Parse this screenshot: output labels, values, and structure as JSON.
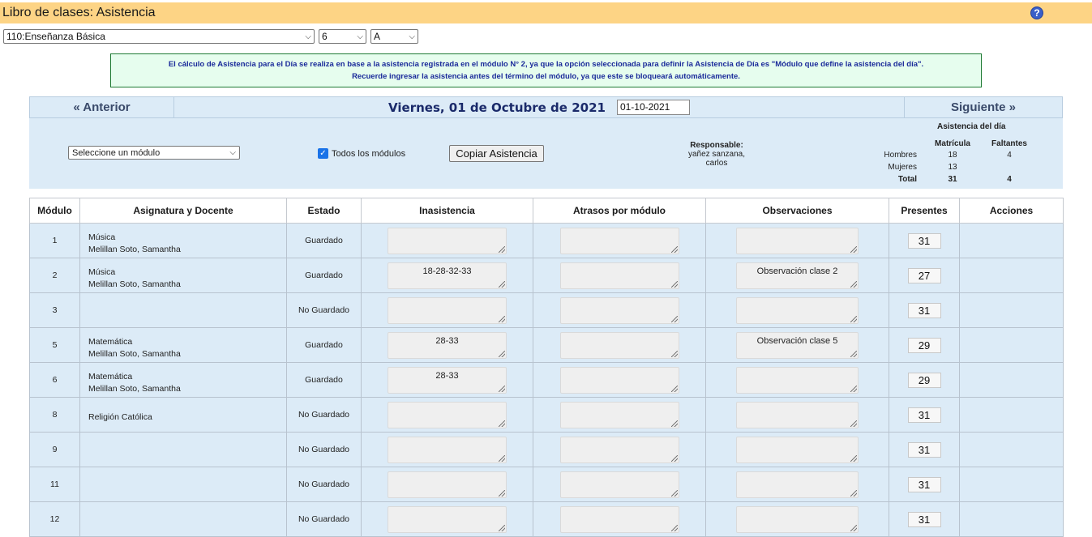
{
  "header": {
    "title": "Libro de clases: Asistencia",
    "help_icon": "?"
  },
  "filters": {
    "curso": "110:Enseñanza Básica",
    "nivel": "6",
    "letra": "A"
  },
  "notice": {
    "line1": "El cálculo de Asistencia para el Día se realiza en base a la asistencia registrada en el módulo N° 2, ya que la opción seleccionada para definir la Asistencia de Día es \"Módulo que define la asistencia del día\".",
    "line2": "Recuerde ingresar la asistencia antes del término del módulo, ya que este se bloqueará automáticamente."
  },
  "nav": {
    "prev_label": "« Anterior",
    "date_label": "Viernes, 01 de Octubre de 2021",
    "date_value": "01-10-2021",
    "next_label": "Siguiente »"
  },
  "controls": {
    "module_placeholder": "Seleccione un módulo",
    "all_modules_label": "Todos los módulos",
    "all_modules_checked": true,
    "copy_button": "Copiar Asistencia",
    "responsable_label": "Responsable:",
    "responsable_line1": "yañez sanzana,",
    "responsable_line2": "carlos"
  },
  "stats": {
    "title": "Asistencia del día",
    "col_matricula": "Matrícula",
    "col_faltantes": "Faltantes",
    "rows": [
      {
        "label": "Hombres",
        "matricula": "18",
        "faltantes": "4"
      },
      {
        "label": "Mujeres",
        "matricula": "13",
        "faltantes": ""
      },
      {
        "label": "Total",
        "matricula": "31",
        "faltantes": "4"
      }
    ]
  },
  "table": {
    "headers": [
      "Módulo",
      "Asignatura y Docente",
      "Estado",
      "Inasistencia",
      "Atrasos por módulo",
      "Observaciones",
      "Presentes",
      "Acciones"
    ],
    "rows": [
      {
        "modulo": "1",
        "asignatura": "Música",
        "docente": "Melillan Soto, Samantha",
        "estado": "Guardado",
        "inasistencia": "",
        "atrasos": "",
        "observaciones": "",
        "presentes": "31"
      },
      {
        "modulo": "2",
        "asignatura": "Música",
        "docente": "Melillan Soto, Samantha",
        "estado": "Guardado",
        "inasistencia": "18-28-32-33",
        "atrasos": "",
        "observaciones": "Observación clase 2",
        "presentes": "27"
      },
      {
        "modulo": "3",
        "asignatura": "",
        "docente": "",
        "estado": "No Guardado",
        "inasistencia": "",
        "atrasos": "",
        "observaciones": "",
        "presentes": "31"
      },
      {
        "modulo": "5",
        "asignatura": "Matemática",
        "docente": "Melillan Soto, Samantha",
        "estado": "Guardado",
        "inasistencia": "28-33",
        "atrasos": "",
        "observaciones": "Observación clase 5",
        "presentes": "29"
      },
      {
        "modulo": "6",
        "asignatura": "Matemática",
        "docente": "Melillan Soto, Samantha",
        "estado": "Guardado",
        "inasistencia": "28-33",
        "atrasos": "",
        "observaciones": "",
        "presentes": "29"
      },
      {
        "modulo": "8",
        "asignatura": "Religión Católica",
        "docente": "",
        "estado": "No Guardado",
        "inasistencia": "",
        "atrasos": "",
        "observaciones": "",
        "presentes": "31"
      },
      {
        "modulo": "9",
        "asignatura": "",
        "docente": "",
        "estado": "No Guardado",
        "inasistencia": "",
        "atrasos": "",
        "observaciones": "",
        "presentes": "31"
      },
      {
        "modulo": "11",
        "asignatura": "",
        "docente": "",
        "estado": "No Guardado",
        "inasistencia": "",
        "atrasos": "",
        "observaciones": "",
        "presentes": "31"
      },
      {
        "modulo": "12",
        "asignatura": "",
        "docente": "",
        "estado": "No Guardado",
        "inasistencia": "",
        "atrasos": "",
        "observaciones": "",
        "presentes": "31"
      }
    ]
  },
  "colors": {
    "topbar": "#fdd485",
    "panel": "#dcebf7",
    "notice_bg": "#e6fdee",
    "notice_border": "#1e7a33",
    "help_icon": "#3a5fc8"
  }
}
